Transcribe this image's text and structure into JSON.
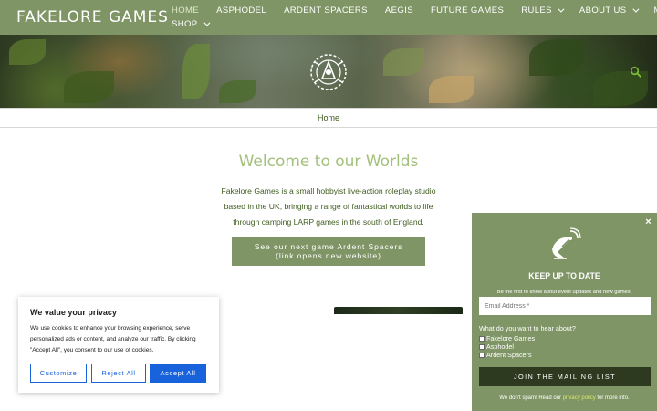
{
  "header": {
    "logo": "FAKELORE GAMES",
    "nav_row1": [
      {
        "label": "HOME",
        "dropdown": false,
        "active": true
      },
      {
        "label": "ASPHODEL",
        "dropdown": false,
        "active": false
      },
      {
        "label": "ARDENT SPACERS",
        "dropdown": false,
        "active": false
      },
      {
        "label": "AEGIS",
        "dropdown": false,
        "active": false
      },
      {
        "label": "FUTURE GAMES",
        "dropdown": false,
        "active": false
      },
      {
        "label": "RULES",
        "dropdown": true,
        "active": false
      },
      {
        "label": "ABOUT US",
        "dropdown": true,
        "active": false
      },
      {
        "label": "MY ACCOUNT",
        "dropdown": false,
        "active": false
      }
    ],
    "nav_row2": [
      {
        "label": "SHOP",
        "dropdown": true,
        "active": false
      }
    ]
  },
  "breadcrumb": "Home",
  "main": {
    "heading": "Welcome to our Worlds",
    "intro": "Fakelore Games is a small hobbyist live-action roleplay studio based in the UK, bringing a range of fantastical worlds to life through camping LARP games in the south of England.",
    "cta_line1": "See our next game Ardent Spacers",
    "cta_line2": "(link opens new website)"
  },
  "cookie": {
    "title": "We value your privacy",
    "text": "We use cookies to enhance your browsing experience, serve personalized ads or content, and analyze our traffic. By clicking \"Accept All\", you consent to our use of cookies.",
    "customize": "Customize",
    "reject": "Reject All",
    "accept": "Accept All"
  },
  "newsletter": {
    "close": "×",
    "title": "KEEP UP TO DATE",
    "subtitle": "Be the first to know about event updates and new games.",
    "email_placeholder": "Email Address *",
    "question": "What do you want to hear about?",
    "options": [
      "Fakelore Games",
      "Asphodel",
      "Ardent Spacers"
    ],
    "join": "JOIN THE MAILING LIST",
    "footer_prefix": "We don't spam! Read our ",
    "footer_link": "privacy policy",
    "footer_suffix": " for more info."
  },
  "colors": {
    "brand_green": "#7f9566",
    "accent_blue": "#1863dc",
    "heading_green": "#a3c07b",
    "dark_button": "#2d3a20"
  },
  "icons": {
    "search": "search-icon",
    "emblem": "fakelore-emblem-icon",
    "satellite": "satellite-dish-icon",
    "close": "close-icon",
    "dropdown": "chevron-down-icon"
  }
}
